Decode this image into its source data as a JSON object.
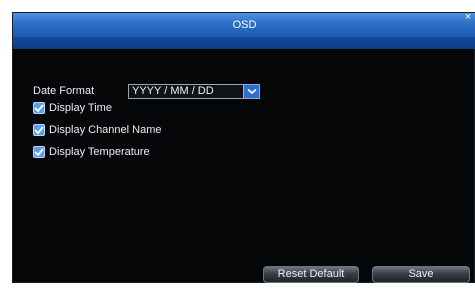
{
  "dialog": {
    "title": "OSD",
    "close_glyph": "×"
  },
  "fields": {
    "date_format_label": "Date Format",
    "date_format_value": "YYYY / MM / DD"
  },
  "options": [
    {
      "label": "Display Time",
      "checked": true
    },
    {
      "label": "Display Channel Name",
      "checked": true
    },
    {
      "label": "Display Temperature",
      "checked": true
    }
  ],
  "buttons": {
    "reset_label": "Reset Default",
    "save_label": "Save"
  },
  "icons": {
    "dropdown": "chevron-down-icon",
    "checkbox": "check-icon",
    "close": "close-icon"
  },
  "colors": {
    "title_bar": "#2c6fc7",
    "title_strip": "#1349a0",
    "dialog_background": "#050608",
    "checkbox": "#5d9fe6",
    "button": "#3b4048"
  }
}
